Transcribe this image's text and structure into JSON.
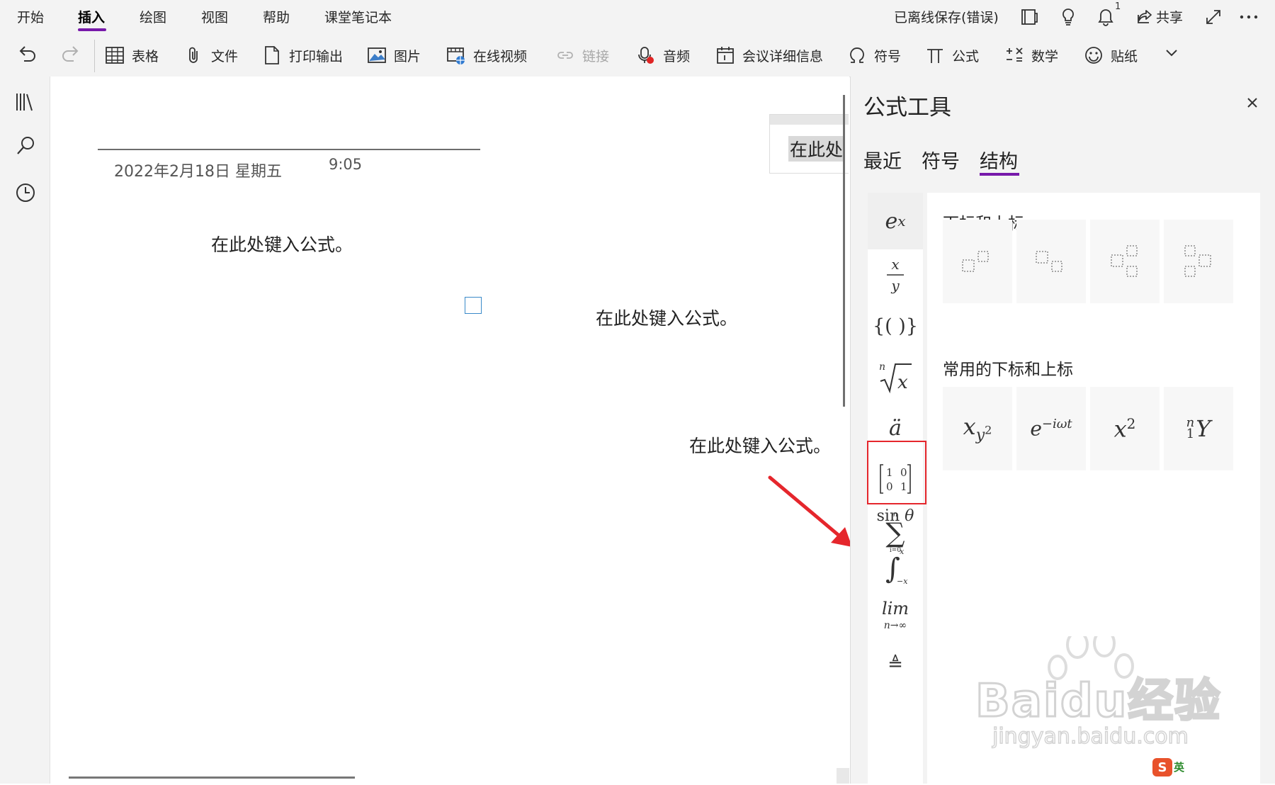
{
  "menu": {
    "items": [
      "开始",
      "插入",
      "绘图",
      "视图",
      "帮助",
      "课堂笔记本"
    ],
    "active": "插入",
    "status": "已离线保存(错误)",
    "notification_count": "1",
    "share_label": "共享"
  },
  "ribbon": {
    "table": "表格",
    "file": "文件",
    "printout": "打印输出",
    "picture": "图片",
    "online_video": "在线视频",
    "link": "链接",
    "audio": "音频",
    "meeting": "会议详细信息",
    "symbol": "符号",
    "equation": "公式",
    "math": "数学",
    "sticker": "贴纸"
  },
  "page": {
    "date": "2022年2月18日 星期五",
    "time": "9:05",
    "equation_placeholder": "在此处键入公式。",
    "equation_placeholder_partial": "在此处",
    "equation_placeholder_fragment": "在此"
  },
  "pane": {
    "title": "公式工具",
    "tabs": [
      "最近",
      "符号",
      "结构"
    ],
    "active_tab": "结构",
    "section1_title": "下标和上标",
    "section2_title": "常用的下标和上标",
    "common_tiles": [
      "x_{y^2}",
      "e^{-iωt}",
      "x^2",
      "{}^n_1Y"
    ],
    "categories": [
      "e^x",
      "x/y",
      "{()}",
      "ⁿ√x",
      "ä",
      "[1 0; 0 1]",
      "Σ",
      "sin θ",
      "∫",
      "lim",
      "≜"
    ],
    "selected_category": "e^x",
    "highlighted_category": "Σ"
  },
  "watermark": {
    "brand": "Baidu经验",
    "url": "jingyan.baidu.com",
    "ime_label": "英"
  },
  "colors": {
    "accent": "#7719aa",
    "annotation": "#e5262c",
    "ribbon_bg": "#f3f3f3"
  }
}
